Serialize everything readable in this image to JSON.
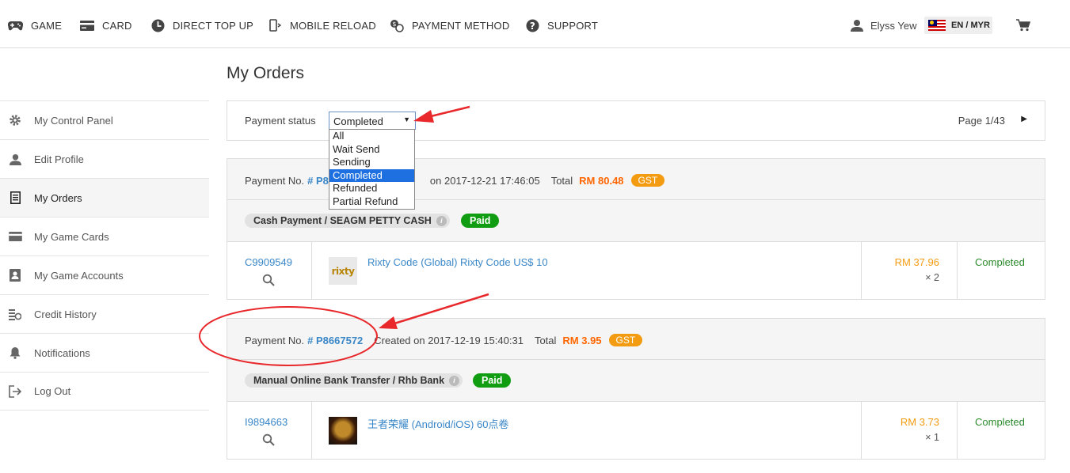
{
  "nav": {
    "items": [
      {
        "label": "GAME",
        "icon": "gamepad-icon"
      },
      {
        "label": "CARD",
        "icon": "card-icon"
      },
      {
        "label": "DIRECT TOP UP",
        "icon": "topup-icon"
      },
      {
        "label": "MOBILE RELOAD",
        "icon": "mobile-icon"
      },
      {
        "label": "PAYMENT METHOD",
        "icon": "payment-icon"
      },
      {
        "label": "SUPPORT",
        "icon": "help-icon"
      }
    ],
    "user_name": "Elyss Yew",
    "lang": "EN / MYR"
  },
  "sidebar": {
    "items": [
      {
        "label": "My Control Panel",
        "icon": "gear-icon"
      },
      {
        "label": "Edit Profile",
        "icon": "user-icon"
      },
      {
        "label": "My Orders",
        "icon": "orders-icon",
        "active": true
      },
      {
        "label": "My Game Cards",
        "icon": "card-icon"
      },
      {
        "label": "My Game Accounts",
        "icon": "account-icon"
      },
      {
        "label": "Credit History",
        "icon": "coins-icon"
      },
      {
        "label": "Notifications",
        "icon": "bell-icon"
      },
      {
        "label": "Log Out",
        "icon": "logout-icon"
      }
    ]
  },
  "main": {
    "title": "My Orders",
    "filter": {
      "label": "Payment status",
      "selected": "Completed",
      "options": [
        "All",
        "Wait Send",
        "Sending",
        "Completed",
        "Refunded",
        "Partial Refund"
      ],
      "page": "Page 1/43"
    },
    "orders": [
      {
        "pay_no_label": "Payment No.",
        "pay_no": "# P8",
        "created": "on 2017-12-21 17:46:05",
        "total_label": "Total",
        "total": "RM 80.48",
        "gst": "GST",
        "method": "Cash Payment / SEAGM PETTY CASH",
        "paid": "Paid",
        "item": {
          "code": "C9909549",
          "name": "Rixty Code (Global) Rixty Code US$ 10",
          "price": "RM 37.96",
          "qty": "× 2",
          "status": "Completed",
          "thumb_text": "rixty"
        }
      },
      {
        "pay_no_label": "Payment No.",
        "pay_no": "# P8667572",
        "created": "Created on 2017-12-19 15:40:31",
        "total_label": "Total",
        "total": "RM 3.95",
        "gst": "GST",
        "method": "Manual Online Bank Transfer / Rhb Bank",
        "paid": "Paid",
        "item": {
          "code": "I9894663",
          "name": "王者荣耀 (Android/iOS) 60点卷",
          "price": "RM 3.73",
          "qty": "× 1",
          "status": "Completed"
        }
      }
    ]
  },
  "colors": {
    "link": "#3a87c8",
    "price": "#ff6600",
    "paid": "#119d11",
    "gst": "#f39c12",
    "annotation": "#e8282b"
  }
}
